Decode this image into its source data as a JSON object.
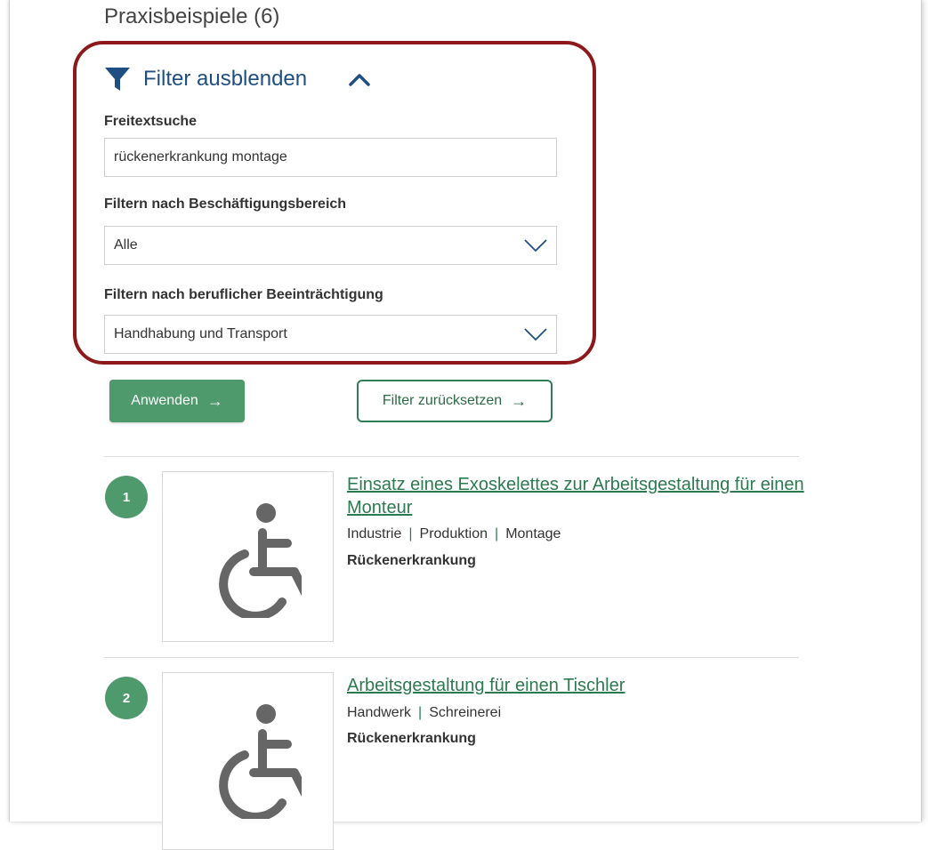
{
  "page": {
    "title": "Praxisbeispiele (6)"
  },
  "filter": {
    "toggle_label": "Filter ausblenden",
    "freetext_label": "Freitextsuche",
    "freetext_value": "rückenerkrankung montage",
    "employment_label": "Filtern nach Beschäftigungsbereich",
    "employment_value": "Alle",
    "impairment_label": "Filtern nach beruflicher Beeinträchtigung",
    "impairment_value": "Handhabung und Transport",
    "apply_label": "Anwenden",
    "reset_label": "Filter zurücksetzen"
  },
  "results": [
    {
      "number": "1",
      "title": "Einsatz eines Exoskelettes zur Arbeitsgestaltung für einen Monteur",
      "tags": [
        "Industrie",
        "Produktion",
        "Montage"
      ],
      "condition": "Rückenerkrankung"
    },
    {
      "number": "2",
      "title": "Arbeitsgestaltung für einen Tischler",
      "tags": [
        "Handwerk",
        "Schreinerei"
      ],
      "condition": "Rückenerkrankung"
    }
  ],
  "colors": {
    "accent_green": "#4e9a6c",
    "link_green": "#2c7a50",
    "filter_blue": "#1f4f82",
    "highlight_red": "#8c1a1a"
  },
  "icons": {
    "filter": "funnel-icon",
    "collapse": "chevron-up-icon",
    "dropdown": "chevron-down-icon",
    "arrow": "arrow-right-icon",
    "thumbnail": "wheelchair-icon"
  }
}
